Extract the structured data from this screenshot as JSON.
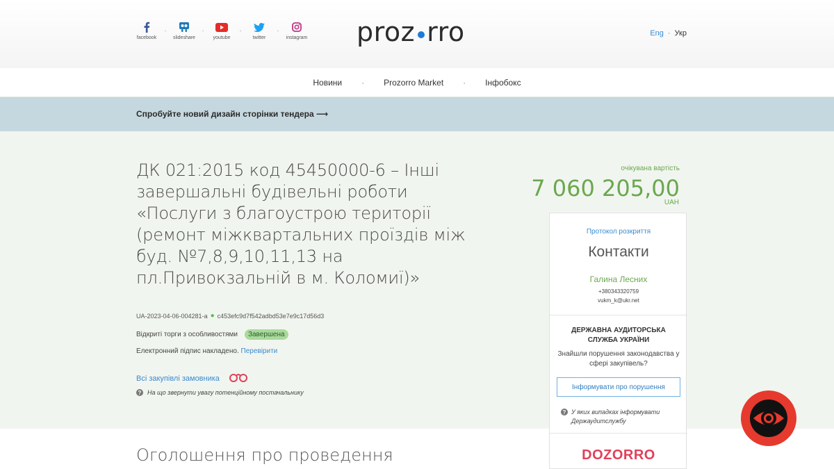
{
  "social": [
    {
      "name": "facebook",
      "icon": "facebook-icon",
      "color": "#3b5998"
    },
    {
      "name": "slideshare",
      "icon": "slideshare-icon",
      "color": "#1f7ab8"
    },
    {
      "name": "youtube",
      "icon": "youtube-icon",
      "color": "#e52d27"
    },
    {
      "name": "twitter",
      "icon": "twitter-icon",
      "color": "#1da1f2"
    },
    {
      "name": "instagram",
      "icon": "instagram-icon",
      "color": "#c13584"
    }
  ],
  "logo": {
    "left": "proz",
    "right": "rro"
  },
  "lang": {
    "en": "Eng",
    "uk": "Укр"
  },
  "nav": [
    "Новини",
    "Prozorro Market",
    "Інфобокс"
  ],
  "banner": {
    "text": "Спробуйте новий дизайн сторінки тендера ⟶"
  },
  "tender": {
    "title_lines": [
      "ДК 021:2015 код 45450000-6 – Інші",
      "завершальні будівельні роботи",
      "«Послуги з благоустрою території",
      "(ремонт міжквартальних проїздів між",
      "буд. №7,8,9,10,11,13 на",
      "пл.Привокзальній в м. Коломиї)»"
    ],
    "id": "UA-2023-04-06-004281-a",
    "hash": "c453efc9d7f542adbd53e7e9c17d56d3",
    "procedure": "Відкриті торги з особливостями",
    "status": "Завершена",
    "signature": "Електронний підпис накладено.",
    "verify": "Перевірити",
    "all_purchases": "Всі закупівлі замовника",
    "hint": "На що звернути увагу потенційному постачальнику"
  },
  "price": {
    "label": "очікувана вартість",
    "value": "7 060 205,00",
    "currency": "UAH"
  },
  "sidebar": {
    "protocol": "Протокол розкриття",
    "contacts_title": "Контакти",
    "contact_name": "Галина Лесних",
    "phone": "+380343320759",
    "email": "vukm_k@ukr.net",
    "audit_title": "ДЕРЖАВНА АУДИТОРСЬКА СЛУЖБА УКРАЇНИ",
    "audit_question": "Знайшли порушення законодавства у сфері закупівель?",
    "audit_button": "Інформувати про порушення",
    "audit_note": "У яких випадках інформувати Держаудитслужбу",
    "dozorro": "DOZORRO"
  },
  "section_title": "Оголошення про проведення",
  "colors": {
    "accent_green": "#6aa84f",
    "link_blue": "#3a8bd0",
    "banner": "#c6d8df",
    "dozorro_red": "#e0405a"
  }
}
